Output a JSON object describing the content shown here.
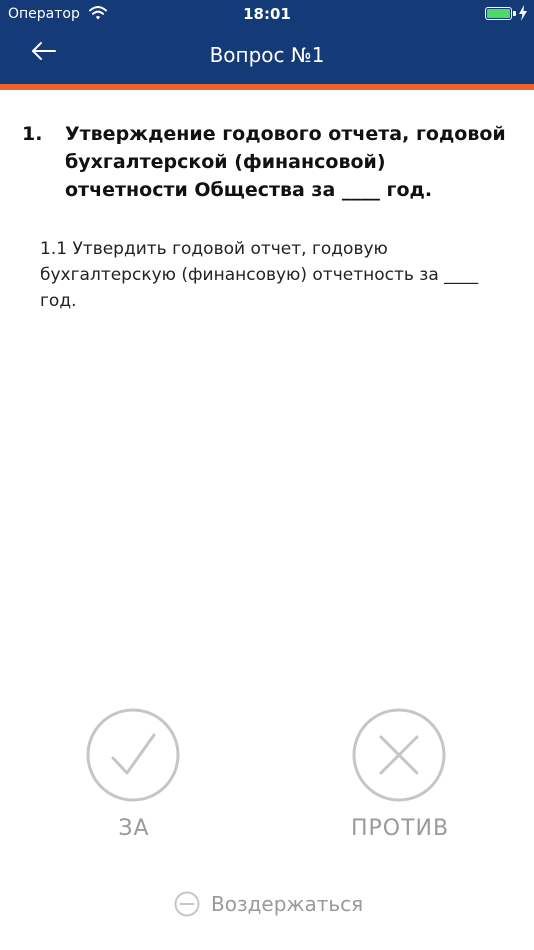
{
  "status_bar": {
    "carrier": "Оператор",
    "time": "18:01",
    "battery_percent": 100
  },
  "nav": {
    "title": "Вопрос №1",
    "back_icon": "arrow-left-icon"
  },
  "colors": {
    "header_bg": "#143a78",
    "accent": "#f0612b",
    "battery": "#4cd964",
    "vote_gray": "#c6c6c6"
  },
  "question": {
    "number": "1.",
    "text": "Утверждение годового отчета, годовой бухгалтерской (финансовой) отчетности Общества за ____ год."
  },
  "subquestion": {
    "text": "1.1 Утвердить годовой отчет, годовую бухгалтерскую (финансовую) отчетность за ____ год."
  },
  "votes": {
    "for_label": "ЗА",
    "for_icon": "checkmark-icon",
    "against_label": "ПРОТИВ",
    "against_icon": "cross-icon",
    "abstain_label": "Воздержаться",
    "abstain_icon": "minus-circle-icon"
  }
}
